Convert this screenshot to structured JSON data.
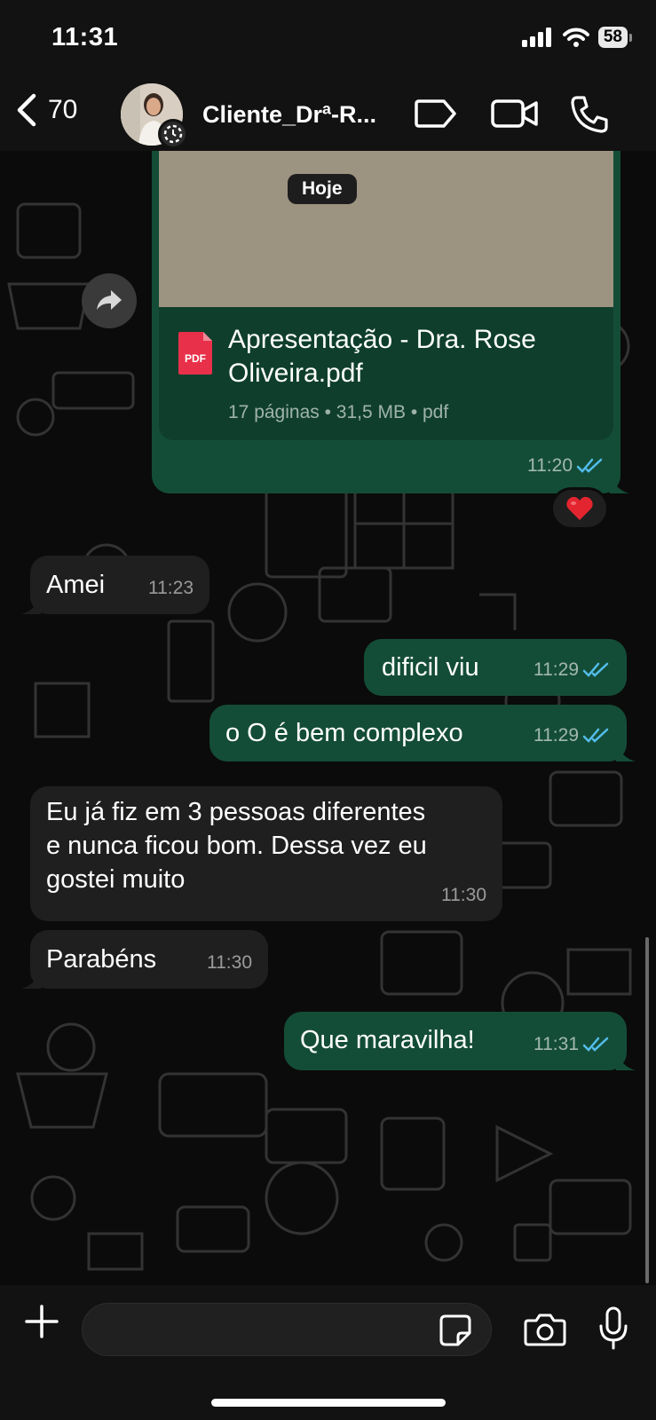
{
  "status_bar": {
    "time": "11:31",
    "battery": "58"
  },
  "header": {
    "back_count": "70",
    "contact_name": "Cliente_Drª-R..."
  },
  "date_chip": "Hoje",
  "messages": [
    {
      "kind": "document",
      "direction": "out",
      "title": "Apresentação - Dra. Rose Oliveira.pdf",
      "title_line1": "Apresentação - Dra. Rose",
      "title_line2": "Oliveira.pdf",
      "pages": "17 páginas",
      "size": "31,5 MB",
      "type": "pdf",
      "details": "17 páginas • 31,5 MB • pdf",
      "time": "11:20",
      "reaction": "❤️",
      "read": true
    },
    {
      "direction": "in",
      "text": "Amei",
      "time": "11:23"
    },
    {
      "direction": "out",
      "text": "dificil viu",
      "time": "11:29",
      "read": true
    },
    {
      "direction": "out",
      "text": "o O é bem complexo",
      "time": "11:29",
      "read": true
    },
    {
      "direction": "in",
      "text_line1": "Eu já fiz em 3 pessoas diferentes",
      "text_line2": "e nunca ficou bom. Dessa vez eu",
      "text_line3": "gostei muito",
      "time": "11:30"
    },
    {
      "direction": "in",
      "text": "Parabéns",
      "time": "11:30"
    },
    {
      "direction": "out",
      "text": "Que maravilha!",
      "time": "11:31",
      "read": true
    }
  ],
  "input": {
    "placeholder": ""
  },
  "colors": {
    "outgoing_bubble": "#144d37",
    "incoming_bubble": "#1f1f1f",
    "read_ticks": "#53bdeb",
    "background": "#0b0b0b"
  },
  "icons": [
    "back-chevron-icon",
    "label-tag-icon",
    "video-call-icon",
    "phone-icon",
    "forward-icon",
    "pdf-icon",
    "plus-icon",
    "sticker-icon",
    "camera-icon",
    "microphone-icon"
  ]
}
